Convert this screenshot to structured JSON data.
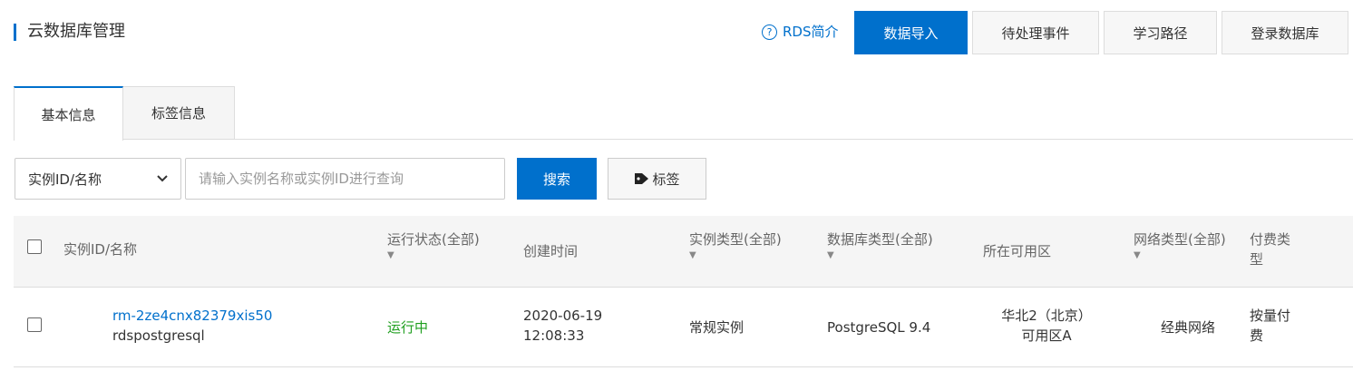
{
  "header": {
    "title": "云数据库管理",
    "help_label": "RDS简介",
    "help_icon": "?",
    "buttons": [
      "数据导入",
      "待处理事件",
      "学习路径",
      "登录数据库"
    ]
  },
  "tabs": [
    {
      "label": "基本信息",
      "active": true
    },
    {
      "label": "标签信息",
      "active": false
    }
  ],
  "search": {
    "select_value": "实例ID/名称",
    "placeholder": "请输入实例名称或实例ID进行查询",
    "search_label": "搜索",
    "tag_label": "标签"
  },
  "table": {
    "columns": [
      {
        "label": "实例ID/名称"
      },
      {
        "label": "运行状态(全部)",
        "sortable": true
      },
      {
        "label": "创建时间"
      },
      {
        "label": "实例类型(全部)",
        "sortable": true
      },
      {
        "label": "数据库类型(全部)",
        "sortable": true
      },
      {
        "label": "所在可用区"
      },
      {
        "label": "网络类型(全部)",
        "sortable": true
      },
      {
        "label_line1": "付费类",
        "label_line2": "型"
      }
    ],
    "rows": [
      {
        "instance_id": "rm-2ze4cnx82379xis50",
        "instance_name": "rdspostgresql",
        "status": "运行中",
        "created_date": "2020-06-19",
        "created_time": "12:08:33",
        "instance_type": "常规实例",
        "db_type": "PostgreSQL 9.4",
        "zone_line1": "华北2（北京）",
        "zone_line2": "可用区A",
        "network": "经典网络",
        "billing_line1": "按量付",
        "billing_line2": "费"
      }
    ]
  },
  "colors": {
    "accent": "#0070cc",
    "status_running": "#1e9e1e"
  }
}
